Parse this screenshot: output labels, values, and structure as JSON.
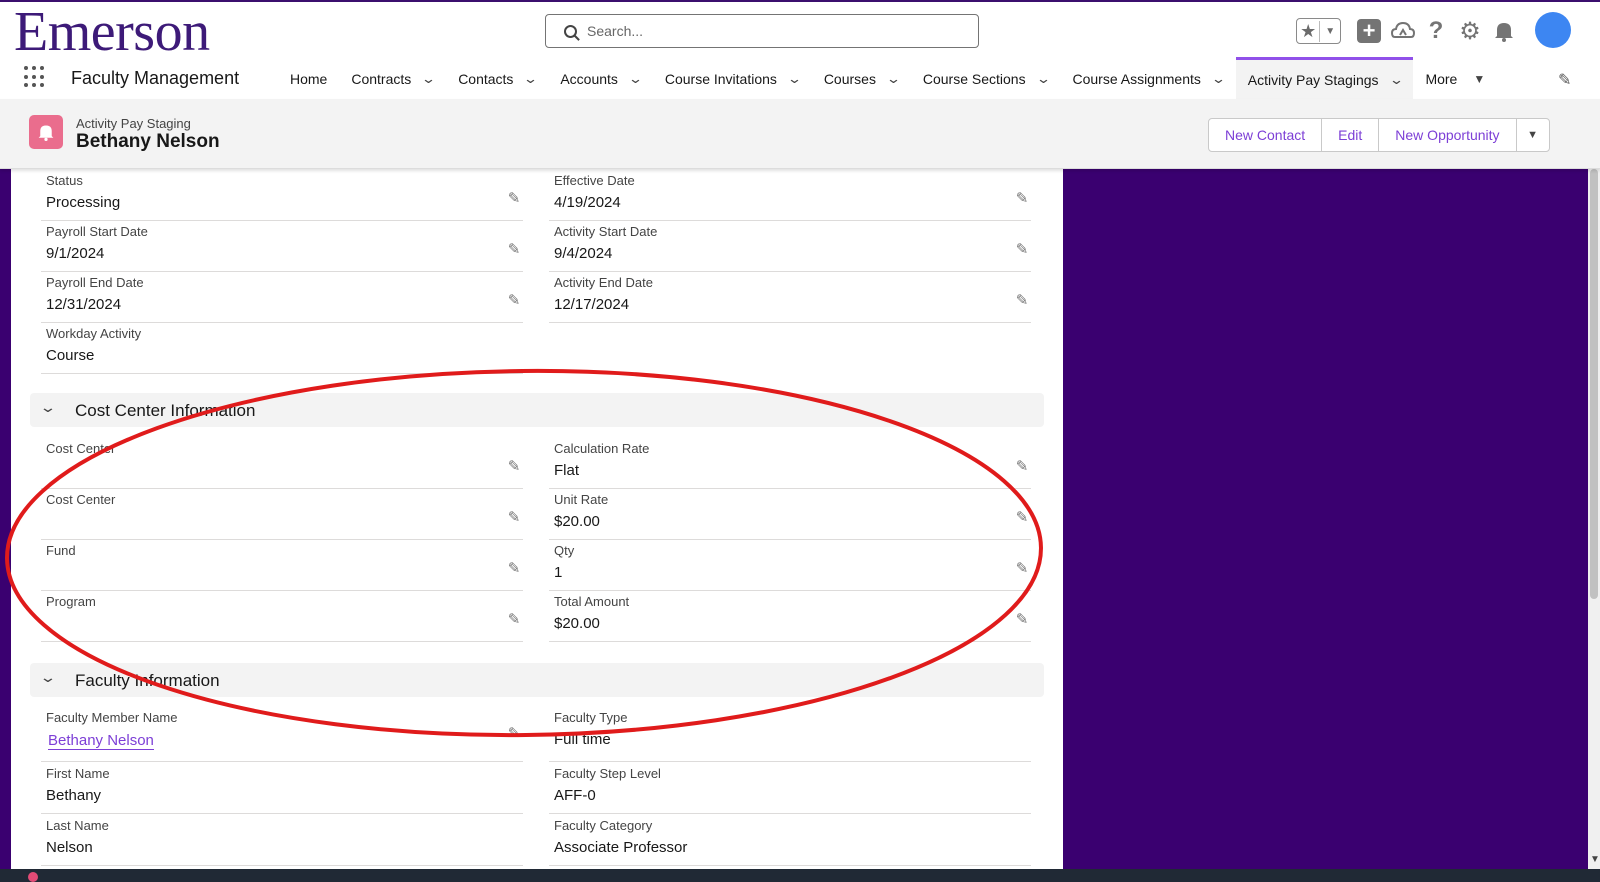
{
  "global_header": {
    "logo": "Emerson",
    "search_placeholder": "Search...",
    "icons": [
      "star-icon",
      "plus-icon",
      "cloud-icon",
      "help-icon",
      "gear-icon",
      "bell-icon"
    ]
  },
  "nav": {
    "app_name": "Faculty Management",
    "items": [
      {
        "label": "Home"
      },
      {
        "label": "Contracts"
      },
      {
        "label": "Contacts"
      },
      {
        "label": "Accounts"
      },
      {
        "label": "Course Invitations"
      },
      {
        "label": "Courses"
      },
      {
        "label": "Course Sections"
      },
      {
        "label": "Course Assignments"
      },
      {
        "label": "Activity Pay Stagings"
      },
      {
        "label": "More"
      }
    ],
    "active": "Activity Pay Stagings"
  },
  "record": {
    "type": "Activity Pay Staging",
    "name": "Bethany Nelson",
    "actions": {
      "new_contact": "New Contact",
      "edit": "Edit",
      "new_opportunity": "New Opportunity"
    }
  },
  "fields": {
    "status": {
      "label": "Status",
      "value": "Processing"
    },
    "effective_date": {
      "label": "Effective Date",
      "value": "4/19/2024"
    },
    "payroll_start": {
      "label": "Payroll Start Date",
      "value": "9/1/2024"
    },
    "activity_start": {
      "label": "Activity Start Date",
      "value": "9/4/2024"
    },
    "payroll_end": {
      "label": "Payroll End Date",
      "value": "12/31/2024"
    },
    "activity_end": {
      "label": "Activity End Date",
      "value": "12/17/2024"
    },
    "workday_activity": {
      "label": "Workday Activity",
      "value": "Course"
    }
  },
  "cost_center_section": {
    "title": "Cost Center Information",
    "cost_center_1": {
      "label": "Cost Center",
      "value": ""
    },
    "calculation_rate": {
      "label": "Calculation Rate",
      "value": "Flat"
    },
    "cost_center_2": {
      "label": "Cost Center",
      "value": ""
    },
    "unit_rate": {
      "label": "Unit Rate",
      "value": "$20.00"
    },
    "fund": {
      "label": "Fund",
      "value": ""
    },
    "qty": {
      "label": "Qty",
      "value": "1"
    },
    "program": {
      "label": "Program",
      "value": ""
    },
    "total_amount": {
      "label": "Total Amount",
      "value": "$20.00"
    }
  },
  "faculty_section": {
    "title": "Faculty Information",
    "faculty_member_name": {
      "label": "Faculty Member Name",
      "value": "Bethany Nelson"
    },
    "faculty_type": {
      "label": "Faculty Type",
      "value": "Full time"
    },
    "first_name": {
      "label": "First Name",
      "value": "Bethany"
    },
    "faculty_step_level": {
      "label": "Faculty Step Level",
      "value": "AFF-0"
    },
    "last_name": {
      "label": "Last Name",
      "value": "Nelson"
    },
    "faculty_category": {
      "label": "Faculty Category",
      "value": "Associate Professor"
    }
  },
  "colors": {
    "brand_purple": "#3d1a78",
    "background": "#3a0070",
    "accent": "#9050e9",
    "link": "#7d3fd6",
    "record_icon": "#ea6d8d",
    "annotation": "#e01b1b"
  }
}
